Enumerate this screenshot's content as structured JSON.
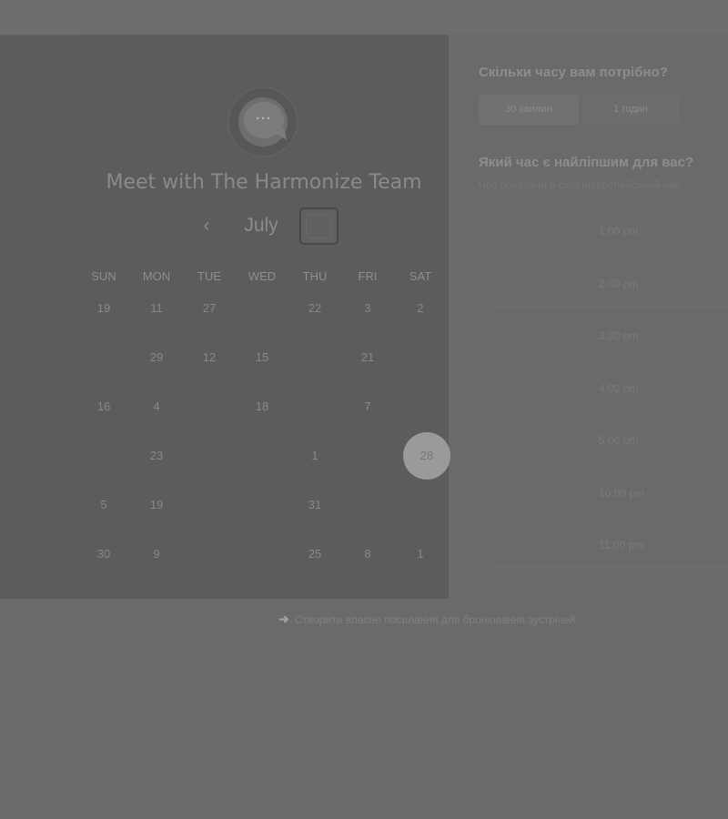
{
  "calendar": {
    "avatar_icon": "chat-bubble-icon",
    "avatar_text": "···",
    "title": "Meet with The Harmonize Team",
    "month": "July",
    "prev_icon": "chevron-left-icon",
    "prev_glyph": "‹",
    "next_icon": "chevron-right-icon",
    "weekdays": [
      "SUN",
      "MON",
      "TUE",
      "WED",
      "THU",
      "FRI",
      "SAT"
    ],
    "weeks": [
      [
        "19",
        "11",
        "27",
        "",
        "22",
        "3",
        "2"
      ],
      [
        "",
        "29",
        "12",
        "15",
        "",
        "21",
        ""
      ],
      [
        "16",
        "4",
        "",
        "18",
        "",
        "7",
        ""
      ],
      [
        "",
        "23",
        "",
        "",
        "1",
        "",
        "28"
      ],
      [
        "5",
        "19",
        "",
        "",
        "31",
        "",
        ""
      ],
      [
        "30",
        "9",
        "",
        "",
        "25",
        "8",
        "1"
      ]
    ],
    "selected_day": "28"
  },
  "panel": {
    "duration_question": "Скільки часу вам потрібно?",
    "duration_options": [
      "30 хвилин",
      "1 годин"
    ],
    "time_question": "Який час є найліпшим для вас?",
    "timezone_text": "Час показано в східноєвропейський час",
    "time_slots": [
      "1:00 pm",
      "2:00 pm",
      "3:00 pm",
      "4:00 pm",
      "5:00 pm",
      "10:00 pm",
      "11:00 pm"
    ]
  },
  "footer": {
    "arrow_icon": "arrow-right-icon",
    "link_text": "Створити власне посилання для бронювання зустрічей"
  },
  "colors": {
    "overlay_bg": "#6a6a6a",
    "card_bg": "#5c5c5c",
    "selected_day_bg": "#9a9a9a"
  }
}
